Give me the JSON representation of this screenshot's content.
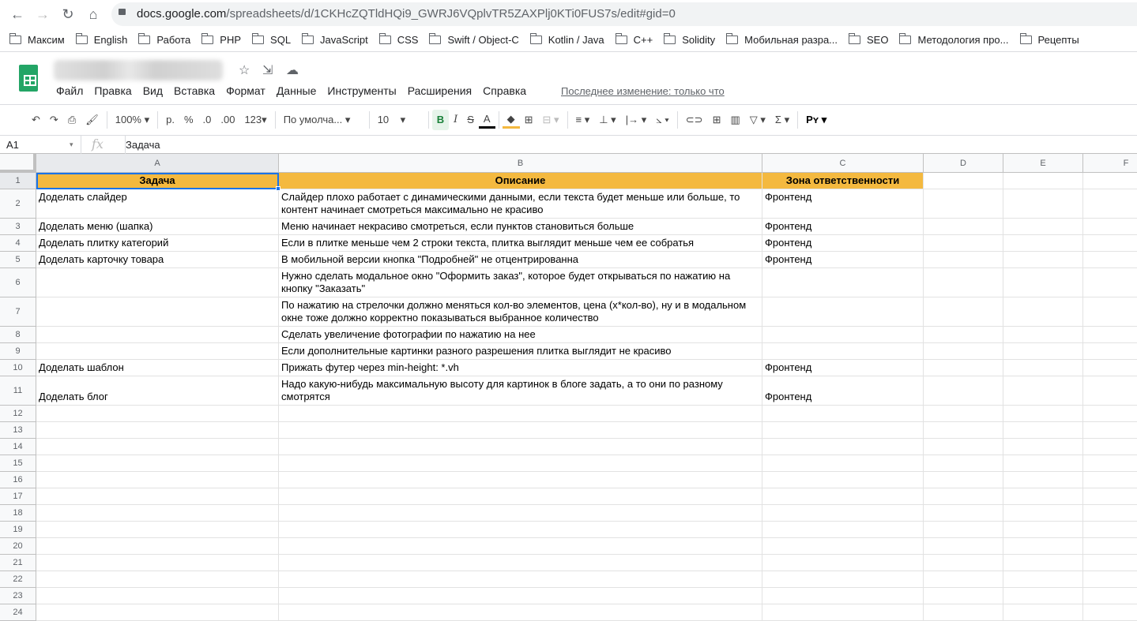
{
  "browser": {
    "url_host": "docs.google.com",
    "url_path": "/spreadsheets/d/1CKHcZQTldHQi9_GWRJ6VQplvTR5ZAXPlj0KTi0FUS7s/edit#gid=0",
    "bookmarks": [
      "Максим",
      "English",
      "Работа",
      "PHP",
      "SQL",
      "JavaScript",
      "CSS",
      "Swift / Object-C",
      "Kotlin / Java",
      "C++",
      "Solidity",
      "Мобильная разра...",
      "SEO",
      "Методология про...",
      "Рецепты"
    ]
  },
  "app": {
    "menu": [
      "Файл",
      "Правка",
      "Вид",
      "Вставка",
      "Формат",
      "Данные",
      "Инструменты",
      "Расширения",
      "Справка"
    ],
    "last_edit": "Последнее изменение: только что",
    "brand_color": "#23a566"
  },
  "toolbar": {
    "zoom": "100%",
    "currency": "р.",
    "percent": "%",
    "dec_less": ".0",
    "dec_more": ".00",
    "format": "123",
    "font": "По умолча...",
    "size": "10",
    "bold": "B",
    "italic": "I",
    "strike": "S",
    "text_color": "A",
    "function": "Σ",
    "input_tools": "Pʏ"
  },
  "formula_bar": {
    "cell_ref": "A1",
    "fx": "fx",
    "value": "Задача"
  },
  "sheet": {
    "columns": [
      "A",
      "B",
      "C",
      "D",
      "E",
      "F"
    ],
    "header_color": "#f4b93f",
    "selected": "A1",
    "rows": [
      [
        "Задача",
        "Описание",
        "Зона ответственности"
      ],
      [
        "Доделать слайдер",
        "Слайдер плохо работает с динамическими данными, если текста будет меньше или больше, то контент начинает смотреться максимально не красиво",
        "Фронтенд"
      ],
      [
        "Доделать меню (шапка)",
        "Меню начинает некрасиво смотреться, если пунктов становиться больше",
        "Фронтенд"
      ],
      [
        "Доделать плитку категорий",
        "Если в плитке меньше чем 2 строки текста, плитка выглядит меньше чем ее собратья",
        "Фронтенд"
      ],
      [
        "Доделать карточку товара",
        "В мобильной версии кнопка \"Подробней\" не отцентрированна",
        "Фронтенд"
      ],
      [
        "",
        "Нужно сделать модальное окно \"Оформить заказ\", которое будет открываться по нажатию на кнопку \"Заказать\"",
        ""
      ],
      [
        "",
        "По нажатию на стрелочки должно меняться кол-во элементов, цена (х*кол-во), ну и в модальном окне тоже должно корректно показываться выбранное количество",
        ""
      ],
      [
        "",
        "Сделать увеличение фотографии по нажатию на нее",
        ""
      ],
      [
        "",
        "Если дополнительные картинки разного разрешения плитка выглядит не красиво",
        ""
      ],
      [
        "Доделать шаблон",
        "Прижать футер через min-height: *.vh",
        "Фронтенд"
      ],
      [
        "Доделать блог",
        "Надо какую-нибудь максимальную высоту для картинок в блоге задать, а то они по разному смотрятся",
        "Фронтенд"
      ]
    ],
    "row_numbers": [
      "1",
      "2",
      "3",
      "4",
      "5",
      "6",
      "7",
      "8",
      "9",
      "10",
      "11",
      "12",
      "13",
      "14",
      "15",
      "16",
      "17",
      "18",
      "19",
      "20",
      "21",
      "22",
      "23",
      "24"
    ]
  }
}
